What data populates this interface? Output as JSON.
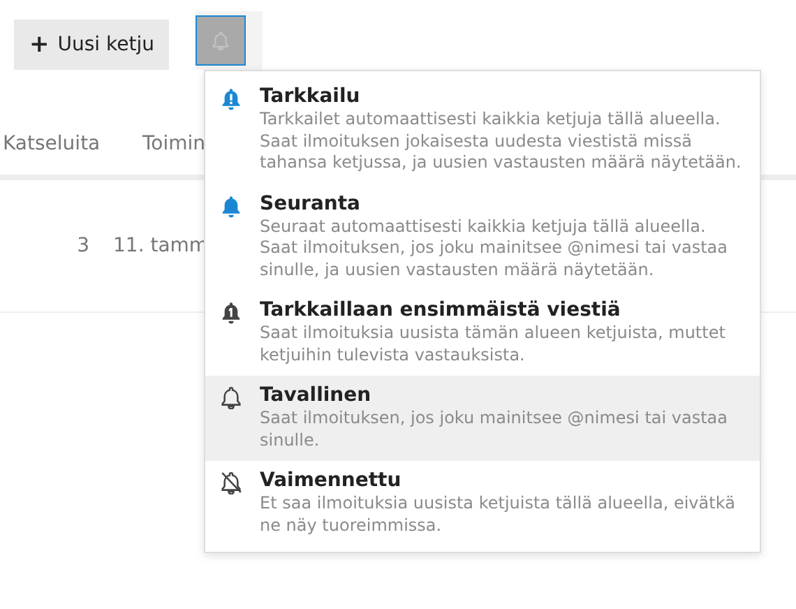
{
  "toolbar": {
    "new_thread_button": {
      "icon": "+",
      "label": "Uusi ketju"
    },
    "notification_button": {
      "open": true
    }
  },
  "table": {
    "columns": [
      "Katseluita",
      "Toimin"
    ],
    "rows": [
      {
        "cells": [
          "3",
          "11. tamm"
        ]
      }
    ]
  },
  "notification_menu": {
    "items": [
      {
        "kind": "tracking",
        "title": "Tarkkailu",
        "description": "Tarkkailet automaattisesti kaikkia ketjuja tällä alueella. Saat ilmoituksen jokaisesta uudesta viestistä missä tahansa ketjussa, ja uusien vastausten määrä näytetään.",
        "selected": false
      },
      {
        "kind": "watching",
        "title": "Seuranta",
        "description": "Seuraat automaattisesti kaikkia ketjuja tällä alueella. Saat ilmoituksen, jos joku mainitsee @nimesi tai vastaa sinulle, ja uusien vastausten määrä näytetään.",
        "selected": false
      },
      {
        "kind": "first_post",
        "title": "Tarkkaillaan ensimmäistä viestiä",
        "description": "Saat ilmoituksia uusista tämän alueen ketjuista, muttet ketjuihin tulevista vastauksista.",
        "selected": false
      },
      {
        "kind": "regular",
        "title": "Tavallinen",
        "description": "Saat ilmoituksen, jos joku mainitsee @nimesi tai vastaa sinulle.",
        "selected": true
      },
      {
        "kind": "muted",
        "title": "Vaimennettu",
        "description": "Et saa ilmoituksia uusista ketjuista tällä alueella, eivätkä ne näy tuoreimmissa.",
        "selected": false
      }
    ]
  }
}
